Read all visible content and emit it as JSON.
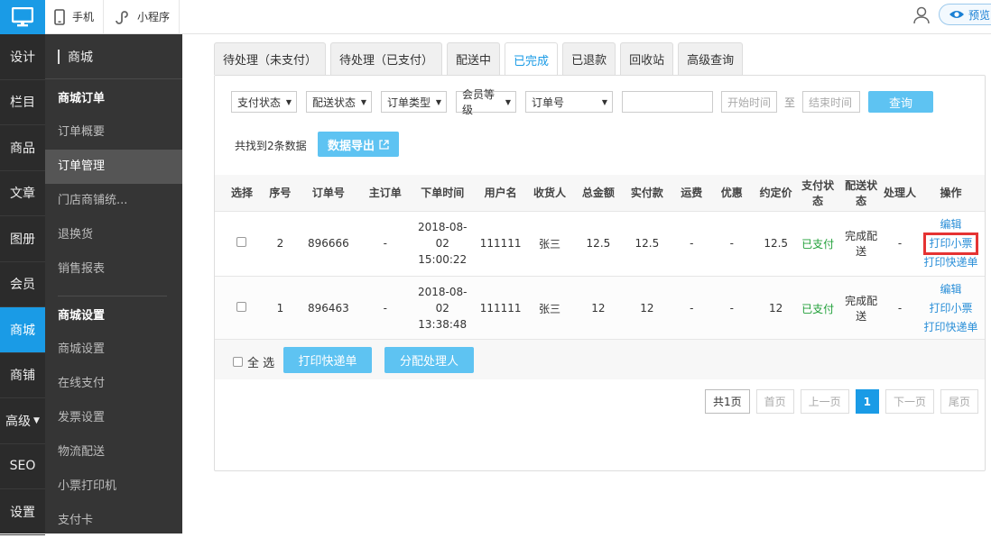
{
  "rail": [
    "设计",
    "栏目",
    "商品",
    "文章",
    "图册",
    "会员",
    "商城",
    "商铺",
    "高级",
    "SEO",
    "设置"
  ],
  "topbar": {
    "phone": "手机",
    "miniapp": "小程序",
    "preview": "预览"
  },
  "side": {
    "title": "商城",
    "group1": "商城订单",
    "links1": [
      "订单概要",
      "订单管理",
      "门店商铺统...",
      "退换货",
      "销售报表"
    ],
    "group2": "商城设置",
    "links2": [
      "商城设置",
      "在线支付",
      "发票设置",
      "物流配送",
      "小票打印机",
      "支付卡"
    ]
  },
  "tabs": [
    "待处理（未支付）",
    "待处理（已支付）",
    "配送中",
    "已完成",
    "已退款",
    "回收站",
    "高级查询"
  ],
  "filters": {
    "pay": "支付状态",
    "ship": "配送状态",
    "type": "订单类型",
    "level": "会员等级",
    "order": "订单号",
    "start": "开始时间",
    "to": "至",
    "end": "结束时间",
    "query": "查询"
  },
  "count": "共找到2条数据",
  "export": "数据导出",
  "headers": [
    "选择",
    "序号",
    "订单号",
    "主订单",
    "下单时间",
    "用户名",
    "收货人",
    "总金额",
    "实付款",
    "运费",
    "优惠",
    "约定价",
    "支付状态",
    "配送状态",
    "处理人",
    "操作"
  ],
  "rows": [
    {
      "idx": "2",
      "order": "896666",
      "main": "-",
      "date": "2018-08-",
      "date2": "02",
      "time": "15:00:22",
      "user": "111111",
      "recv": "张三",
      "total": "12.5",
      "paid": "12.5",
      "freight": "-",
      "disc": "-",
      "agreed": "12.5",
      "paystate": "已支付",
      "shipstate": "完成配送",
      "handler": "-",
      "ops": [
        "编辑",
        "打印小票",
        "打印快递单"
      ]
    },
    {
      "idx": "1",
      "order": "896463",
      "main": "-",
      "date": "2018-08-",
      "date2": "02",
      "time": "13:38:48",
      "user": "111111",
      "recv": "张三",
      "total": "12",
      "paid": "12",
      "freight": "-",
      "disc": "-",
      "agreed": "12",
      "paystate": "已支付",
      "shipstate": "完成配送",
      "handler": "-",
      "ops": [
        "编辑",
        "打印小票",
        "打印快递单"
      ]
    }
  ],
  "bottom": {
    "selall": "全 选",
    "print": "打印快递单",
    "assign": "分配处理人"
  },
  "pager": [
    "共1页",
    "首页",
    "上一页",
    "1",
    "下一页",
    "尾页"
  ]
}
